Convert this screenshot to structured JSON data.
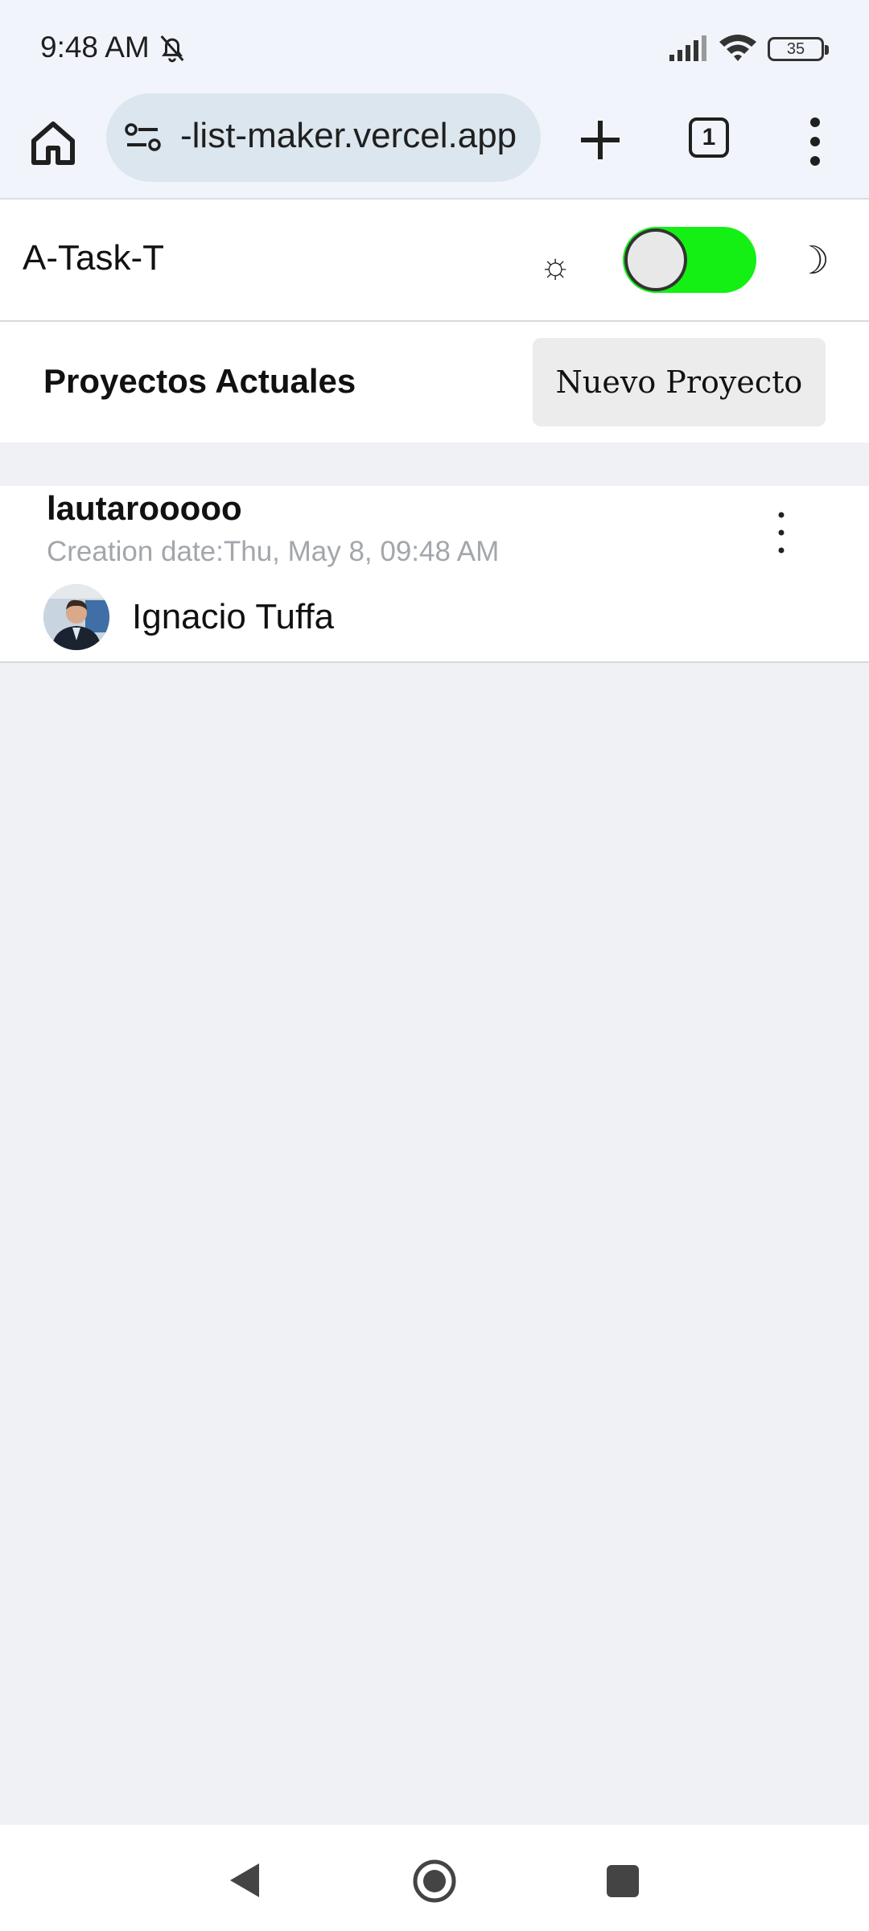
{
  "status_bar": {
    "time": "9:48 AM",
    "battery": "35",
    "icons": [
      "bell-off-icon",
      "signal-icon",
      "wifi-icon",
      "battery-icon"
    ]
  },
  "browser": {
    "url": "-list-maker.vercel.app",
    "tab_count": "1",
    "icons": [
      "home-icon",
      "site-settings-icon",
      "plus-icon",
      "tabs-icon",
      "more-vert-icon"
    ]
  },
  "app": {
    "title": "A-Task-T",
    "theme_toggle": {
      "light_icon": "☼",
      "dark_icon": "☽",
      "state": "on"
    }
  },
  "section": {
    "title": "Proyectos Actuales",
    "new_project_label": "Nuevo Proyecto"
  },
  "projects": [
    {
      "name": "lautarooooo",
      "date": "Creation date:Thu, May 8, 09:48 AM",
      "owner": "Ignacio Tuffa"
    }
  ],
  "colors": {
    "toggle_on": "#14f014",
    "page_bg": "#eff1f5",
    "browser_bg": "#f1f5fb",
    "url_pill": "#dce6ee"
  }
}
